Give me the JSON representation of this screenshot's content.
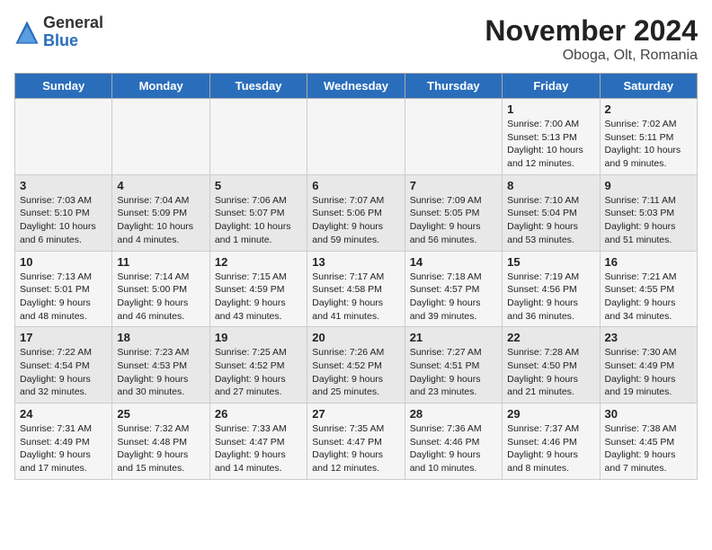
{
  "header": {
    "title": "November 2024",
    "subtitle": "Oboga, Olt, Romania",
    "logo_general": "General",
    "logo_blue": "Blue"
  },
  "days_of_week": [
    "Sunday",
    "Monday",
    "Tuesday",
    "Wednesday",
    "Thursday",
    "Friday",
    "Saturday"
  ],
  "weeks": [
    [
      {
        "day": "",
        "info": ""
      },
      {
        "day": "",
        "info": ""
      },
      {
        "day": "",
        "info": ""
      },
      {
        "day": "",
        "info": ""
      },
      {
        "day": "",
        "info": ""
      },
      {
        "day": "1",
        "info": "Sunrise: 7:00 AM\nSunset: 5:13 PM\nDaylight: 10 hours and 12 minutes."
      },
      {
        "day": "2",
        "info": "Sunrise: 7:02 AM\nSunset: 5:11 PM\nDaylight: 10 hours and 9 minutes."
      }
    ],
    [
      {
        "day": "3",
        "info": "Sunrise: 7:03 AM\nSunset: 5:10 PM\nDaylight: 10 hours and 6 minutes."
      },
      {
        "day": "4",
        "info": "Sunrise: 7:04 AM\nSunset: 5:09 PM\nDaylight: 10 hours and 4 minutes."
      },
      {
        "day": "5",
        "info": "Sunrise: 7:06 AM\nSunset: 5:07 PM\nDaylight: 10 hours and 1 minute."
      },
      {
        "day": "6",
        "info": "Sunrise: 7:07 AM\nSunset: 5:06 PM\nDaylight: 9 hours and 59 minutes."
      },
      {
        "day": "7",
        "info": "Sunrise: 7:09 AM\nSunset: 5:05 PM\nDaylight: 9 hours and 56 minutes."
      },
      {
        "day": "8",
        "info": "Sunrise: 7:10 AM\nSunset: 5:04 PM\nDaylight: 9 hours and 53 minutes."
      },
      {
        "day": "9",
        "info": "Sunrise: 7:11 AM\nSunset: 5:03 PM\nDaylight: 9 hours and 51 minutes."
      }
    ],
    [
      {
        "day": "10",
        "info": "Sunrise: 7:13 AM\nSunset: 5:01 PM\nDaylight: 9 hours and 48 minutes."
      },
      {
        "day": "11",
        "info": "Sunrise: 7:14 AM\nSunset: 5:00 PM\nDaylight: 9 hours and 46 minutes."
      },
      {
        "day": "12",
        "info": "Sunrise: 7:15 AM\nSunset: 4:59 PM\nDaylight: 9 hours and 43 minutes."
      },
      {
        "day": "13",
        "info": "Sunrise: 7:17 AM\nSunset: 4:58 PM\nDaylight: 9 hours and 41 minutes."
      },
      {
        "day": "14",
        "info": "Sunrise: 7:18 AM\nSunset: 4:57 PM\nDaylight: 9 hours and 39 minutes."
      },
      {
        "day": "15",
        "info": "Sunrise: 7:19 AM\nSunset: 4:56 PM\nDaylight: 9 hours and 36 minutes."
      },
      {
        "day": "16",
        "info": "Sunrise: 7:21 AM\nSunset: 4:55 PM\nDaylight: 9 hours and 34 minutes."
      }
    ],
    [
      {
        "day": "17",
        "info": "Sunrise: 7:22 AM\nSunset: 4:54 PM\nDaylight: 9 hours and 32 minutes."
      },
      {
        "day": "18",
        "info": "Sunrise: 7:23 AM\nSunset: 4:53 PM\nDaylight: 9 hours and 30 minutes."
      },
      {
        "day": "19",
        "info": "Sunrise: 7:25 AM\nSunset: 4:52 PM\nDaylight: 9 hours and 27 minutes."
      },
      {
        "day": "20",
        "info": "Sunrise: 7:26 AM\nSunset: 4:52 PM\nDaylight: 9 hours and 25 minutes."
      },
      {
        "day": "21",
        "info": "Sunrise: 7:27 AM\nSunset: 4:51 PM\nDaylight: 9 hours and 23 minutes."
      },
      {
        "day": "22",
        "info": "Sunrise: 7:28 AM\nSunset: 4:50 PM\nDaylight: 9 hours and 21 minutes."
      },
      {
        "day": "23",
        "info": "Sunrise: 7:30 AM\nSunset: 4:49 PM\nDaylight: 9 hours and 19 minutes."
      }
    ],
    [
      {
        "day": "24",
        "info": "Sunrise: 7:31 AM\nSunset: 4:49 PM\nDaylight: 9 hours and 17 minutes."
      },
      {
        "day": "25",
        "info": "Sunrise: 7:32 AM\nSunset: 4:48 PM\nDaylight: 9 hours and 15 minutes."
      },
      {
        "day": "26",
        "info": "Sunrise: 7:33 AM\nSunset: 4:47 PM\nDaylight: 9 hours and 14 minutes."
      },
      {
        "day": "27",
        "info": "Sunrise: 7:35 AM\nSunset: 4:47 PM\nDaylight: 9 hours and 12 minutes."
      },
      {
        "day": "28",
        "info": "Sunrise: 7:36 AM\nSunset: 4:46 PM\nDaylight: 9 hours and 10 minutes."
      },
      {
        "day": "29",
        "info": "Sunrise: 7:37 AM\nSunset: 4:46 PM\nDaylight: 9 hours and 8 minutes."
      },
      {
        "day": "30",
        "info": "Sunrise: 7:38 AM\nSunset: 4:45 PM\nDaylight: 9 hours and 7 minutes."
      }
    ]
  ]
}
